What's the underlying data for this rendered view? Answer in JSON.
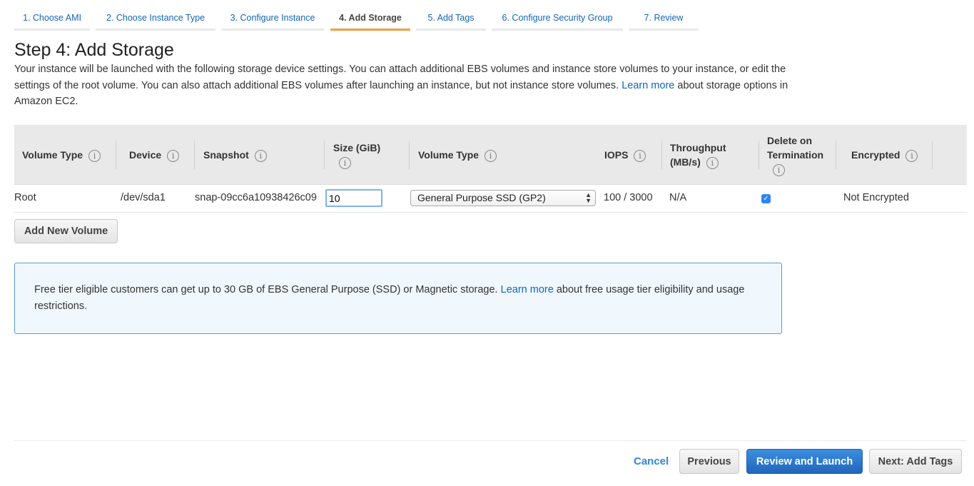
{
  "wizard_tabs": [
    "1. Choose AMI",
    "2. Choose Instance Type",
    "3. Configure Instance",
    "4. Add Storage",
    "5. Add Tags",
    "6. Configure Security Group",
    "7. Review"
  ],
  "title": "Step 4: Add Storage",
  "description": {
    "before": "Your instance will be launched with the following storage device settings. You can attach additional EBS volumes and instance store volumes to your instance, or edit the settings of the root volume. You can also attach additional EBS volumes after launching an instance, but not instance store volumes.",
    "link": "Learn more",
    "after": "about storage options in Amazon EC2."
  },
  "table": {
    "headers": {
      "volume_type": "Volume Type",
      "device": "Device",
      "snapshot": "Snapshot",
      "size": "Size (GiB)",
      "volume_type2": "Volume Type",
      "iops": "IOPS",
      "throughput": "Throughput (MB/s)",
      "delete": "Delete on Termination",
      "encrypted": "Encrypted"
    },
    "info_icon": "i",
    "rows": [
      {
        "volume_type": "Root",
        "device": "/dev/sda1",
        "snapshot": "snap-09cc6a10938426c09",
        "size": "10",
        "ebs_type": "General Purpose SSD (GP2)",
        "iops": "100 / 3000",
        "throughput": "N/A",
        "delete_on_termination": true,
        "encrypted": "Not Encrypted"
      }
    ]
  },
  "add_volume_label": "Add New Volume",
  "notice": {
    "before": "Free tier eligible customers can get up to 30 GB of EBS General Purpose (SSD) or Magnetic storage.",
    "link": "Learn more",
    "after": "about free usage tier eligibility and usage restrictions."
  },
  "footer": {
    "cancel": "Cancel",
    "previous": "Previous",
    "review_launch": "Review and Launch",
    "next": "Next: Add Tags"
  },
  "colors": {
    "link": "#1166bb",
    "primary": "#2d72c4",
    "active_tab": "#f0a040"
  }
}
